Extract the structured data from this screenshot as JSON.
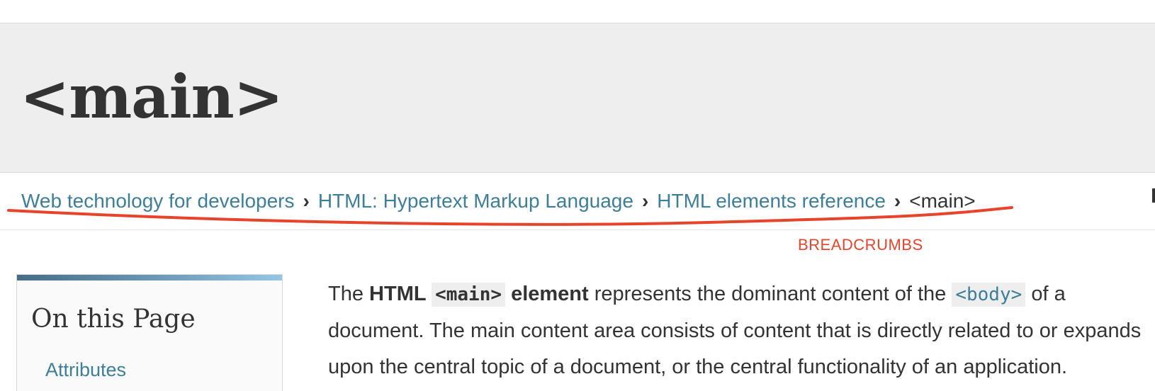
{
  "page": {
    "title": "<main>"
  },
  "breadcrumbs": {
    "items": [
      "Web technology for developers",
      "HTML: Hypertext Markup Language",
      "HTML elements reference"
    ],
    "separator": "›",
    "current": "<main>"
  },
  "annotation": {
    "label": "BREADCRUMBS",
    "color": "#e8432b"
  },
  "toc": {
    "title": "On this Page",
    "items": [
      "Attributes"
    ]
  },
  "article": {
    "intro_the": "The ",
    "intro_bold_html": "HTML ",
    "intro_code_main": "<main>",
    "intro_bold_element": " element",
    "intro_represents": " represents the dominant content of the ",
    "intro_code_body": "<body>",
    "intro_of_a": " of a",
    "line2": "document. The main content area consists of content that is directly related to or expands",
    "line3": "upon the central topic of a document, or the central functionality of an application."
  },
  "colors": {
    "link": "#3d7e9a",
    "title_band": "#eeeeee",
    "text": "#333333"
  }
}
